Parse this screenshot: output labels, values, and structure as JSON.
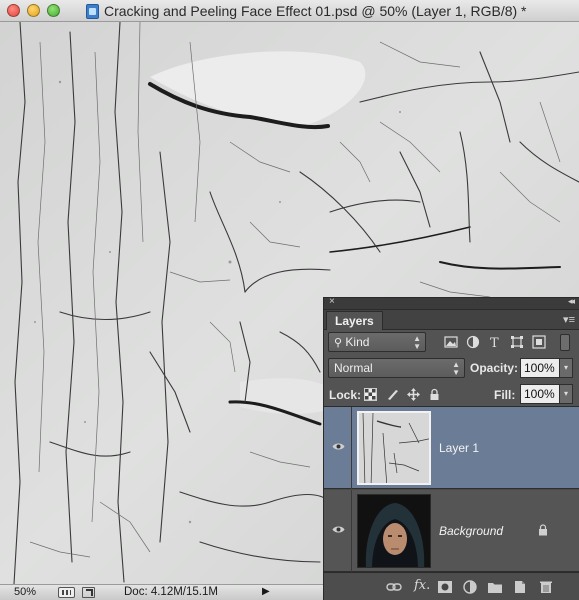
{
  "window": {
    "title": "Cracking and Peeling Face Effect 01.psd @ 50% (Layer 1, RGB/8) *"
  },
  "status_bar": {
    "zoom": "50%",
    "doc_size": "Doc: 4.12M/15.1M"
  },
  "layers_panel": {
    "tab_label": "Layers",
    "filter_kind": "Kind",
    "blend_mode": "Normal",
    "opacity_label": "Opacity:",
    "opacity_value": "100%",
    "lock_label": "Lock:",
    "fill_label": "Fill:",
    "fill_value": "100%",
    "layers": [
      {
        "name": "Layer 1",
        "selected": true,
        "visible": true
      },
      {
        "name": "Background",
        "selected": false,
        "visible": true,
        "locked": true
      }
    ],
    "filter_icons": [
      "image-filter-icon",
      "adjustment-filter-icon",
      "type-filter-icon",
      "shape-filter-icon",
      "smart-object-filter-icon"
    ],
    "lock_icons": [
      "lock-transparent-pixels-icon",
      "lock-image-pixels-icon",
      "lock-position-icon",
      "lock-all-icon"
    ],
    "bottom_icons": [
      "link-layers-icon",
      "fx-icon",
      "add-mask-icon",
      "new-adjustment-layer-icon",
      "new-group-icon",
      "new-layer-icon",
      "delete-layer-icon"
    ]
  },
  "colors": {
    "selected_layer": "#6b7c96",
    "panel_bg": "#535353",
    "canvas_texture": "#d9dad9"
  }
}
